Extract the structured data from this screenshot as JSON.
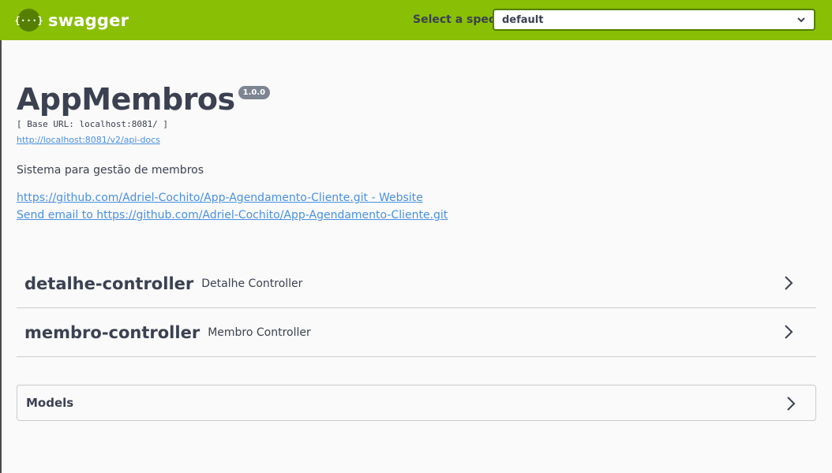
{
  "topbar": {
    "brand_logo_text": "{···}",
    "brand": "swagger",
    "spec_label": "Select a spec",
    "spec_selected": "default"
  },
  "info": {
    "title": "AppMembros",
    "version": "1.0.0",
    "base_url": "[ Base URL: localhost:8081/ ]",
    "api_docs_link": "http://localhost:8081/v2/api-docs",
    "description": "Sistema para gestão de membros",
    "website_link": "https://github.com/Adriel-Cochito/App-Agendamento-Cliente.git - Website",
    "email_link": "Send email to https://github.com/Adriel-Cochito/App-Agendamento-Cliente.git"
  },
  "tags": [
    {
      "name": "detalhe-controller",
      "description": "Detalhe Controller"
    },
    {
      "name": "membro-controller",
      "description": "Membro Controller"
    }
  ],
  "models": {
    "label": "Models"
  },
  "colors": {
    "topbar": "#89bf04",
    "accent_dark": "#547f00",
    "text": "#3b4151",
    "link": "#4990e2",
    "version_badge": "#7d8492"
  },
  "icons": {
    "logo": "swagger-logo-icon",
    "select_arrow": "chevron-down-icon",
    "expand": "chevron-right-icon"
  }
}
